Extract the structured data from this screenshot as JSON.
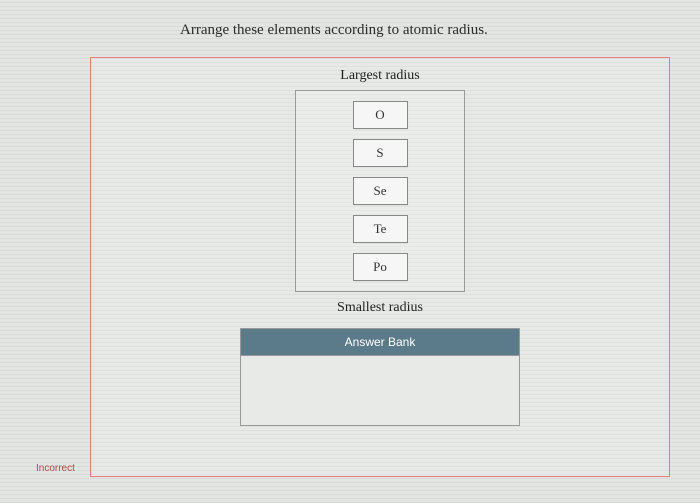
{
  "question": "Arrange these elements according to atomic radius.",
  "rank": {
    "topLabel": "Largest radius",
    "bottomLabel": "Smallest radius",
    "items": [
      "O",
      "S",
      "Se",
      "Te",
      "Po"
    ]
  },
  "answerBank": {
    "header": "Answer Bank"
  },
  "status": "Incorrect"
}
